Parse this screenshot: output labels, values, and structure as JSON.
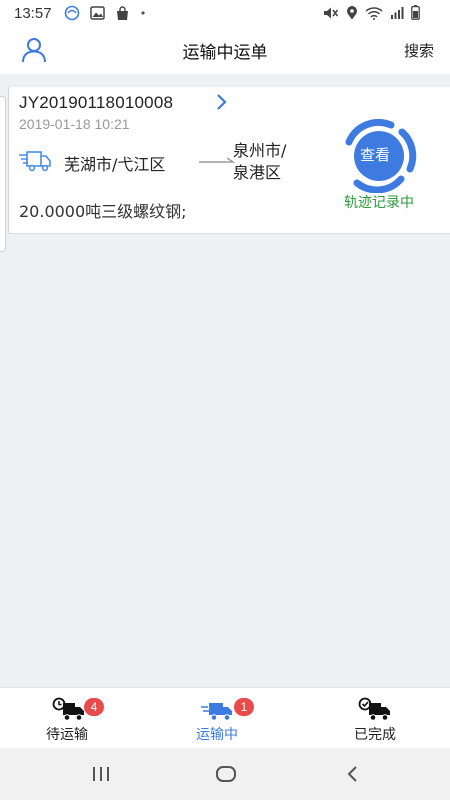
{
  "status_bar": {
    "time": "13:57"
  },
  "header": {
    "title": "运输中运单",
    "search_label": "搜索",
    "user_icon": "user-icon"
  },
  "order": {
    "number": "JY20190118010008",
    "time": "2019-01-18 10:21",
    "from": "芜湖市/弋江区",
    "to_line1": "泉州市/",
    "to_line2": "泉港区",
    "cargo": "20.0000吨三级螺纹钢;",
    "view_label": "查看",
    "track_status": "轨迹记录中"
  },
  "tabs": [
    {
      "label": "待运输",
      "badge": "4",
      "active": false
    },
    {
      "label": "运输中",
      "badge": "1",
      "active": true
    },
    {
      "label": "已完成",
      "badge": "",
      "active": false
    }
  ],
  "colors": {
    "accent": "#3d7be0",
    "badge": "#e84b4b",
    "track_green": "#2e9b3c"
  }
}
